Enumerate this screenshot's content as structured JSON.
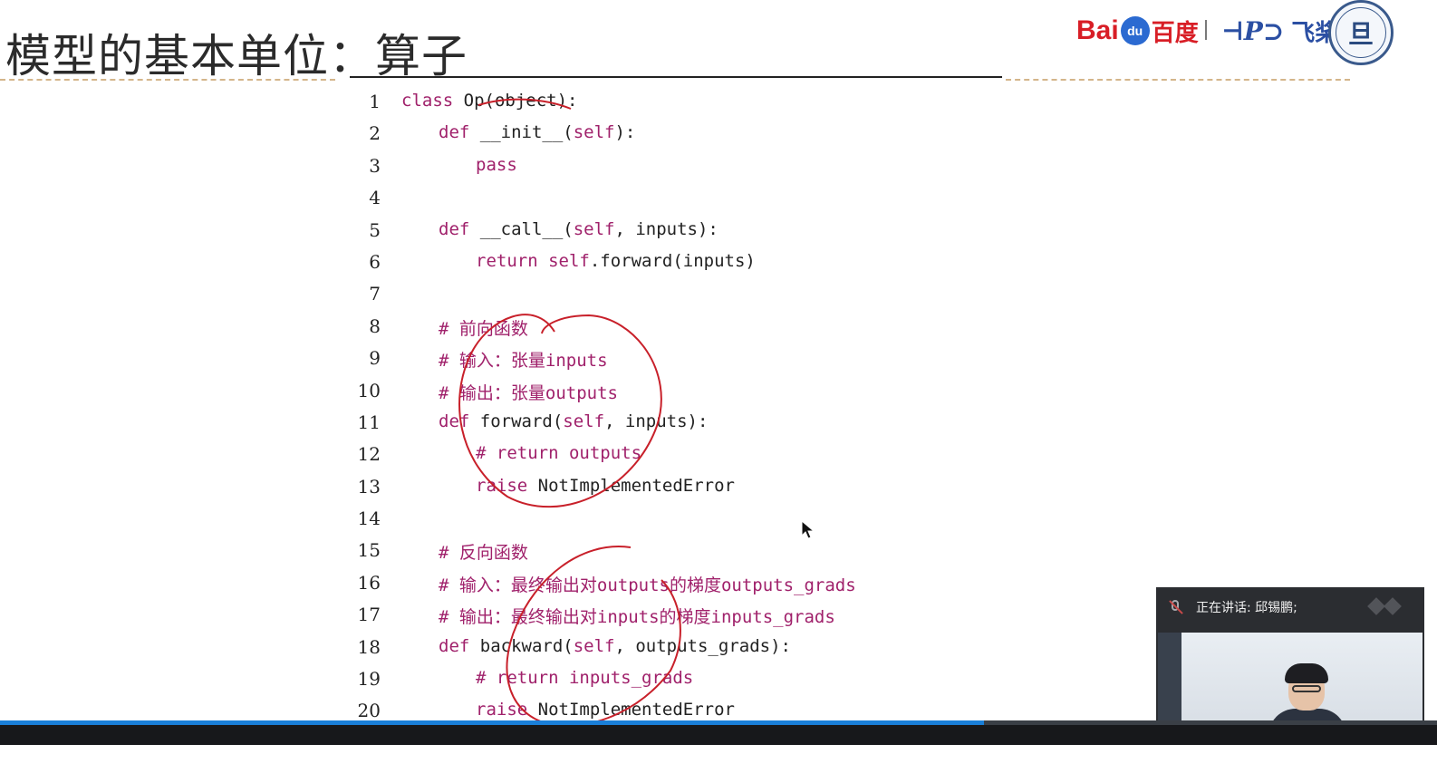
{
  "slide": {
    "title": "模型的基本单位：算子"
  },
  "logos": {
    "baidu_latin": "Bai",
    "baidu_paw": "du",
    "baidu_cn": "百度",
    "paddle_mark": "⊣P⊃",
    "paddle_cn": "飞桨",
    "fudan_mark": "旦"
  },
  "code": {
    "lines": [
      {
        "n": "1"
      },
      {
        "n": "2"
      },
      {
        "n": "3"
      },
      {
        "n": "4"
      },
      {
        "n": "5"
      },
      {
        "n": "6"
      },
      {
        "n": "7"
      },
      {
        "n": "8"
      },
      {
        "n": "9"
      },
      {
        "n": "10"
      },
      {
        "n": "11"
      },
      {
        "n": "12"
      },
      {
        "n": "13"
      },
      {
        "n": "14"
      },
      {
        "n": "15"
      },
      {
        "n": "16"
      },
      {
        "n": "17"
      },
      {
        "n": "18"
      },
      {
        "n": "19"
      },
      {
        "n": "20"
      }
    ],
    "t": {
      "l1_kw": "class",
      "l1_rest": " Op(object):",
      "l2_kw": "def",
      "l2_mid": " __init__(",
      "l2_self": "self",
      "l2_end": "):",
      "l3_kw": "pass",
      "l5_kw": "def",
      "l5_mid": " __call__(",
      "l5_self": "self",
      "l5_end": ", inputs):",
      "l6_kw": "return",
      "l6_self": " self",
      "l6_end": ".forward(inputs)",
      "l8": "# 前向函数",
      "l9": "# 输入：张量inputs",
      "l10": "# 输出：张量outputs",
      "l11_kw": "def",
      "l11_mid": " forward(",
      "l11_self": "self",
      "l11_end": ", inputs):",
      "l12": "# return outputs",
      "l13_kw": "raise",
      "l13_end": " NotImplementedError",
      "l15": "# 反向函数",
      "l16": "# 输入：最终输出对outputs的梯度outputs_grads",
      "l17": "# 输出：最终输出对inputs的梯度inputs_grads",
      "l18_kw": "def",
      "l18_mid": " backward(",
      "l18_self": "self",
      "l18_end": ", outputs_grads):",
      "l19": "# return inputs_grads",
      "l20_kw": "raise",
      "l20_end": " NotImplementedError"
    }
  },
  "meeting": {
    "speaking_label": "正在讲话: 邱锡鹏;",
    "mic_icon": "mic-muted-icon",
    "expand_icon": "expand-icon"
  },
  "playback": {
    "progress_fraction": 0.685
  },
  "colors": {
    "keyword": "#a0216b",
    "annotation_red": "#c8202a",
    "progress": "#1a7fd9"
  }
}
